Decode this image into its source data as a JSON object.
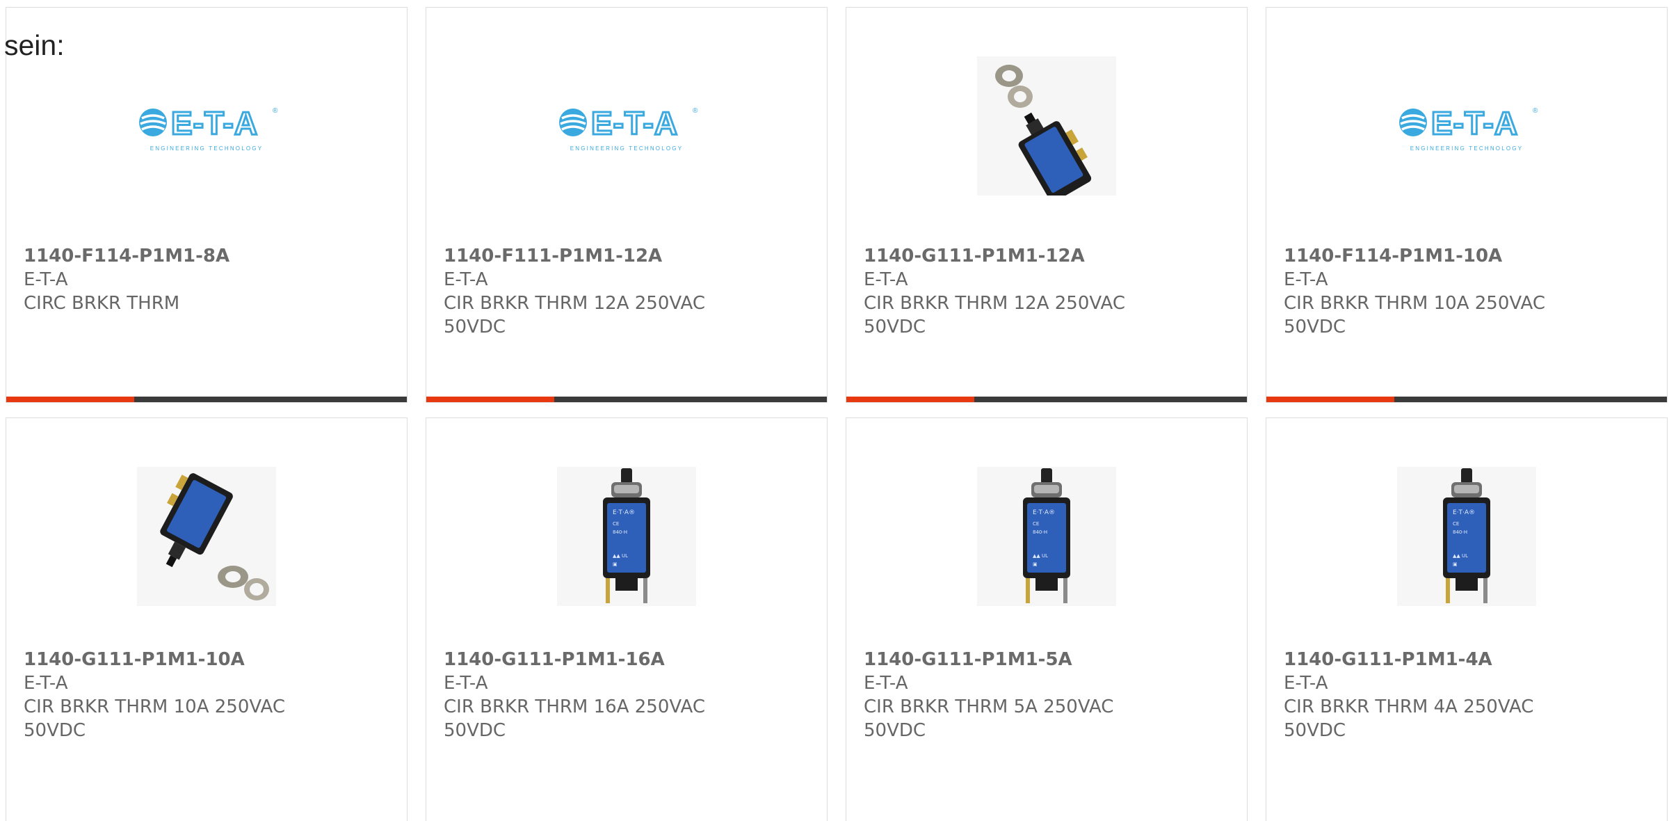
{
  "intro_text": "sein:",
  "colors": {
    "accent": "#e8380f",
    "bar_dark": "#3a3a3a",
    "logo_blue": "#3aa9df"
  },
  "logo": {
    "text": "E-T-A",
    "tagline": "ENGINEERING TECHNOLOGY"
  },
  "products": [
    {
      "part": "1140-F114-P1M1-8A",
      "mfr": "E-T-A",
      "desc": "CIRC BRKR THRM",
      "image": "eta-logo",
      "progress": 0.32
    },
    {
      "part": "1140-F111-P1M1-12A",
      "mfr": "E-T-A",
      "desc": "CIR BRKR THRM 12A 250VAC 50VDC",
      "image": "eta-logo",
      "progress": 0.32
    },
    {
      "part": "1140-G111-P1M1-12A",
      "mfr": "E-T-A",
      "desc": "CIR BRKR THRM 12A 250VAC 50VDC",
      "image": "breaker-angled",
      "progress": 0.32
    },
    {
      "part": "1140-F114-P1M1-10A",
      "mfr": "E-T-A",
      "desc": "CIR BRKR THRM 10A 250VAC 50VDC",
      "image": "eta-logo",
      "progress": 0.32
    },
    {
      "part": "1140-G111-P1M1-10A",
      "mfr": "E-T-A",
      "desc": "CIR BRKR THRM 10A 250VAC 50VDC",
      "image": "breaker-angled-nuts",
      "progress": null
    },
    {
      "part": "1140-G111-P1M1-16A",
      "mfr": "E-T-A",
      "desc": "CIR BRKR THRM 16A 250VAC 50VDC",
      "image": "breaker-front",
      "progress": null
    },
    {
      "part": "1140-G111-P1M1-5A",
      "mfr": "E-T-A",
      "desc": "CIR BRKR THRM 5A 250VAC 50VDC",
      "image": "breaker-front",
      "progress": null
    },
    {
      "part": "1140-G111-P1M1-4A",
      "mfr": "E-T-A",
      "desc": "CIR BRKR THRM 4A 250VAC 50VDC",
      "image": "breaker-front",
      "progress": null
    }
  ]
}
